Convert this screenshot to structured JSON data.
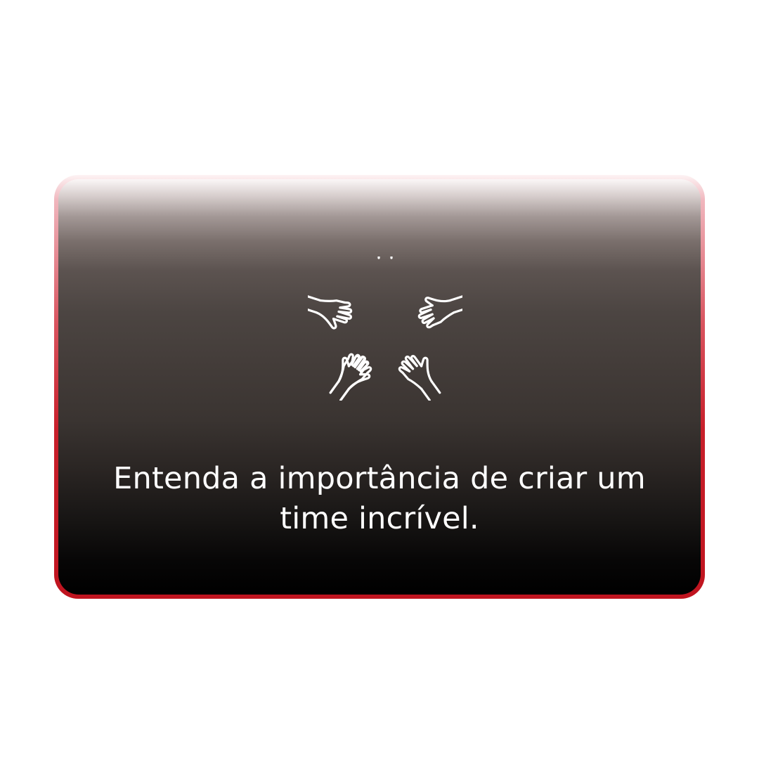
{
  "card": {
    "headline_line1": "Entenda a importância de criar um",
    "headline_line2": "time incrível.",
    "icon": "team-hands-icon",
    "colors": {
      "frame": "#c0141f",
      "card_top": "#6b605d",
      "card_bottom": "#000000",
      "text": "#ffffff",
      "icon_stroke": "#ffffff"
    }
  }
}
